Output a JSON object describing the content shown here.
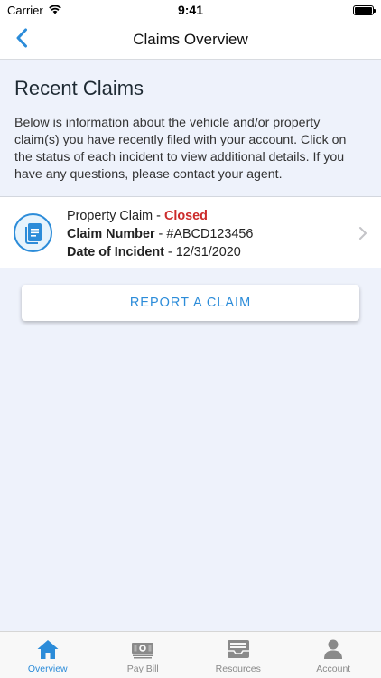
{
  "status_bar": {
    "carrier": "Carrier",
    "time": "9:41",
    "battery_level": 1.0
  },
  "nav": {
    "title": "Claims Overview",
    "back_icon": "chevron-left-icon"
  },
  "intro": {
    "heading": "Recent Claims",
    "description": "Below is information about the vehicle and/or property claim(s) you have recently filed with your account. Click on the status of each incident to view additional details. If you have any questions, please contact your agent."
  },
  "claims": [
    {
      "type": "Property Claim",
      "separator": " - ",
      "status": "Closed",
      "number_label": "Claim Number",
      "number_value": "#ABCD123456",
      "date_label": "Date of Incident",
      "date_value": "12/31/2020",
      "icon": "document-icon"
    }
  ],
  "report_button": {
    "label": "REPORT A CLAIM"
  },
  "tabs": [
    {
      "label": "Overview",
      "icon": "home-icon",
      "active": true
    },
    {
      "label": "Pay Bill",
      "icon": "money-icon",
      "active": false
    },
    {
      "label": "Resources",
      "icon": "inbox-icon",
      "active": false
    },
    {
      "label": "Account",
      "icon": "person-icon",
      "active": false
    }
  ],
  "colors": {
    "accent": "#2c8cd9",
    "closed": "#cc2b2b",
    "background": "#eef2fb"
  }
}
